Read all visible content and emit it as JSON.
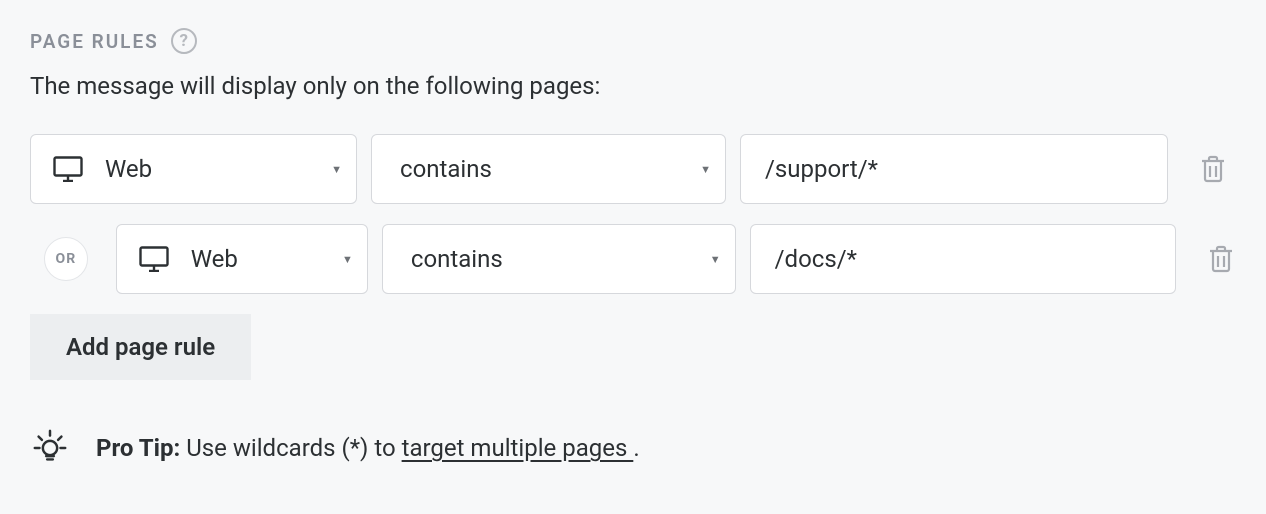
{
  "section": {
    "title": "PAGE RULES",
    "subtitle": "The message will display only on the following pages:",
    "add_button": "Add page rule",
    "or_label": "OR"
  },
  "rules": [
    {
      "platform": "Web",
      "matcher": "contains",
      "value": "/support/*"
    },
    {
      "platform": "Web",
      "matcher": "contains",
      "value": "/docs/*"
    }
  ],
  "protip": {
    "label": "Pro Tip:",
    "text_before": " Use wildcards (*) to ",
    "link": "target multiple pages ",
    "text_after": "."
  }
}
